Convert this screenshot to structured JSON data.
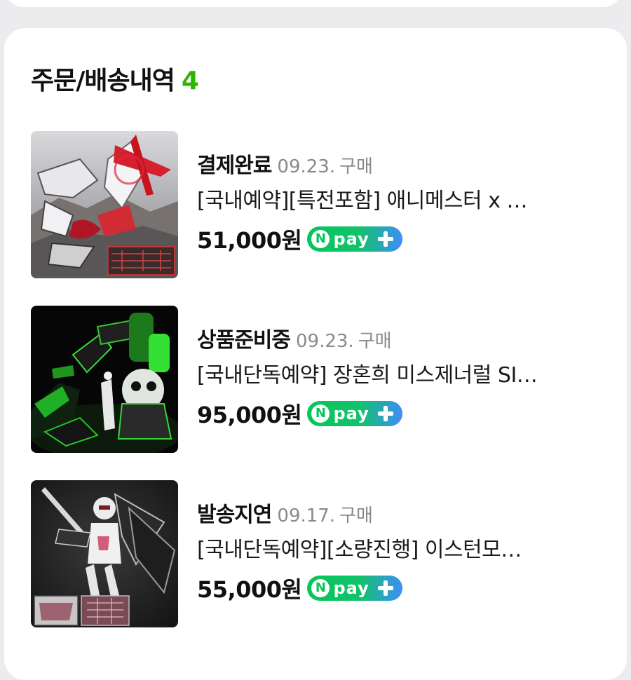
{
  "section": {
    "title": "주문/배송내역",
    "count": "4"
  },
  "orders": [
    {
      "status": "결제완료",
      "date": "09.23.",
      "date_suffix": "구매",
      "title": "[국내예약][특전포함] 애니메스터 x …",
      "price": "51,000원",
      "pay_badge": "pay"
    },
    {
      "status": "상품준비중",
      "date": "09.23.",
      "date_suffix": "구매",
      "title": "[국내단독예약] 장혼희 미스제너럴 SI…",
      "price": "95,000원",
      "pay_badge": "pay"
    },
    {
      "status": "발송지연",
      "date": "09.17.",
      "date_suffix": "구매",
      "title": "[국내단독예약][소량진행] 이스턴모…",
      "price": "55,000원",
      "pay_badge": "pay"
    }
  ],
  "colors": {
    "accent_count": "#2db400",
    "npay_green": "#03c75a",
    "npay_blue": "#3d8ef8"
  },
  "icons": {
    "npay_logo": "npay-plus-logo",
    "thumbnails": [
      "product-photo-white-red-mecha",
      "product-photo-green-mecha",
      "product-photo-white-black-mecha"
    ]
  }
}
